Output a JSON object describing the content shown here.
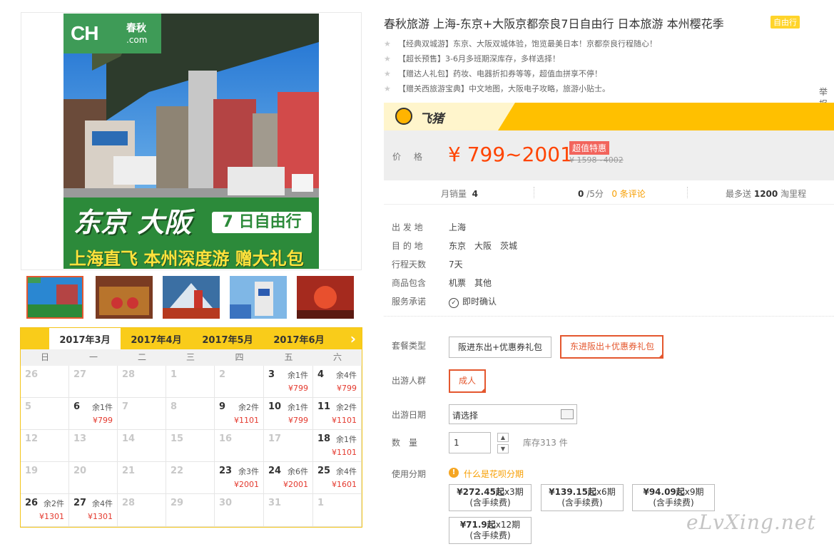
{
  "gallery": {
    "brand": {
      "main": "CH",
      "top": "春秋",
      "bottom": ".com"
    },
    "headline": "东京 大阪",
    "days_tag": "7 日自由行",
    "slogan": "上海直飞 本州深度游 赠大礼包",
    "thumbs": 5
  },
  "calendar": {
    "months": [
      "2017年3月",
      "2017年4月",
      "2017年5月",
      "2017年6月"
    ],
    "active_month": 0,
    "next_icon": "chevron-right-icon",
    "weekdays": [
      "日",
      "一",
      "二",
      "三",
      "四",
      "五",
      "六"
    ],
    "weeks": [
      [
        {
          "d": "26",
          "off": true
        },
        {
          "d": "27",
          "off": true
        },
        {
          "d": "28",
          "off": true
        },
        {
          "d": "1"
        },
        {
          "d": "2"
        },
        {
          "d": "3",
          "r": "余1件",
          "p": "¥799"
        },
        {
          "d": "4",
          "r": "余4件",
          "p": "¥799"
        }
      ],
      [
        {
          "d": "5"
        },
        {
          "d": "6",
          "r": "余1件",
          "p": "¥799"
        },
        {
          "d": "7"
        },
        {
          "d": "8"
        },
        {
          "d": "9",
          "r": "余2件",
          "p": "¥1101"
        },
        {
          "d": "10",
          "r": "余1件",
          "p": "¥799"
        },
        {
          "d": "11",
          "r": "余2件",
          "p": "¥1101"
        }
      ],
      [
        {
          "d": "12"
        },
        {
          "d": "13"
        },
        {
          "d": "14"
        },
        {
          "d": "15"
        },
        {
          "d": "16"
        },
        {
          "d": "17"
        },
        {
          "d": "18",
          "r": "余1件",
          "p": "¥1101"
        }
      ],
      [
        {
          "d": "19"
        },
        {
          "d": "20"
        },
        {
          "d": "21"
        },
        {
          "d": "22"
        },
        {
          "d": "23",
          "r": "余3件",
          "p": "¥2001"
        },
        {
          "d": "24",
          "r": "余6件",
          "p": "¥2001"
        },
        {
          "d": "25",
          "r": "余4件",
          "p": "¥1601"
        }
      ],
      [
        {
          "d": "26",
          "r": "余2件",
          "p": "¥1301"
        },
        {
          "d": "27",
          "r": "余4件",
          "p": "¥1301"
        },
        {
          "d": "28"
        },
        {
          "d": "29"
        },
        {
          "d": "30"
        },
        {
          "d": "31"
        },
        {
          "d": "1",
          "off": true
        }
      ]
    ]
  },
  "product": {
    "title": "春秋旅游 上海-东京+大阪京都奈良7日自由行 日本旅游 本州樱花季",
    "type_badge": "自由行",
    "highlights": [
      "【经典双城游】东京、大阪双城体验，饱览最美日本！京都奈良行程随心！",
      "【超长预售】3-6月多班期深库存，多样选择！",
      "【赠达人礼包】药妆、电器折扣券等等，超值血拼享不停！",
      "【赠关西旅游宝典】中文地图，大阪电子攻略，旅游小贴士。"
    ],
    "report": "举报"
  },
  "fliggy": {
    "name": "飞猪"
  },
  "price": {
    "label": "价格",
    "value": "¥ 799~2001",
    "tag": "超值特惠",
    "original": "¥ 1598~4002"
  },
  "stats": {
    "sales_label": "月销量",
    "sales": "4",
    "rating": "0",
    "rating_unit": "/5分",
    "reviews": "0 条评论",
    "points_prefix": "最多送",
    "points": "1200",
    "points_suffix": "淘里程"
  },
  "details": [
    {
      "label": "出 发 地",
      "values": [
        "上海"
      ]
    },
    {
      "label": "目 的 地",
      "values": [
        "东京",
        "大阪",
        "茨城"
      ]
    },
    {
      "label": "行程天数",
      "values": [
        "7天"
      ]
    },
    {
      "label": "商品包含",
      "values": [
        "机票",
        "其他"
      ]
    },
    {
      "label": "服务承诺",
      "values": [
        "即时确认"
      ]
    }
  ],
  "booking": {
    "package_label": "套餐类型",
    "packages": [
      "阪进东出+优惠券礼包",
      "东进阪出+优惠券礼包"
    ],
    "package_selected": 1,
    "traveler_label": "出游人群",
    "traveler": "成人",
    "date_label": "出游日期",
    "date_value": "请选择",
    "qty_label": "数　量",
    "qty": "1",
    "stock": "库存313 件",
    "installment_label": "使用分期",
    "installment_link": "什么是花呗分期",
    "installments": [
      {
        "amount": "¥272.45起",
        "term": "x3期",
        "fee": "(含手续费)"
      },
      {
        "amount": "¥139.15起",
        "term": "x6期",
        "fee": "(含手续费)"
      },
      {
        "amount": "¥94.09起",
        "term": "x9期",
        "fee": "(含手续费)"
      },
      {
        "amount": "¥71.9起",
        "term": "x12期",
        "fee": "(含手续费)"
      }
    ]
  },
  "watermark": "eLvXing.net",
  "colors": {
    "accent": "#ff4400",
    "yellow": "#f9cc1a",
    "selected": "#e4572e",
    "orange": "#f79e00"
  }
}
